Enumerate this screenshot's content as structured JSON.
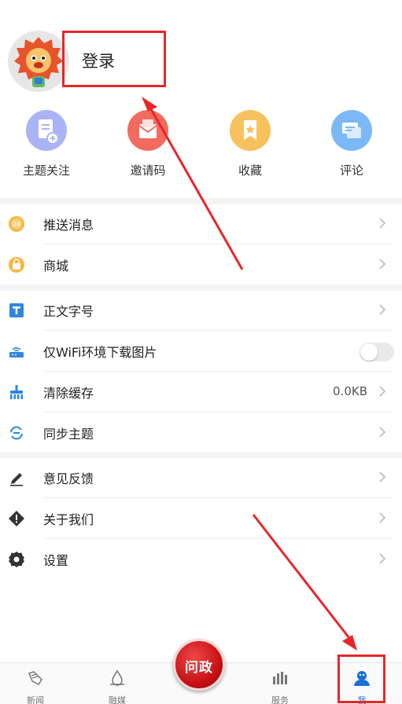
{
  "profile": {
    "login_label": "登录"
  },
  "quick_actions": [
    {
      "label": "主题关注",
      "icon": "topic-follow-icon",
      "color": "#aab3f5"
    },
    {
      "label": "邀请码",
      "icon": "invite-code-icon",
      "color": "#f36a5f"
    },
    {
      "label": "收藏",
      "icon": "favorite-icon",
      "color": "#f7c15d"
    },
    {
      "label": "评论",
      "icon": "comment-icon",
      "color": "#7cb8f5"
    }
  ],
  "section1": [
    {
      "label": "推送消息",
      "icon": "push-message-icon"
    },
    {
      "label": "商城",
      "icon": "mall-icon"
    }
  ],
  "section2": [
    {
      "label": "正文字号",
      "icon": "font-size-icon"
    },
    {
      "label": "仅WiFi环境下载图片",
      "icon": "wifi-router-icon",
      "toggle_on": false
    },
    {
      "label": "清除缓存",
      "icon": "clear-cache-icon",
      "value": "0.0KB"
    },
    {
      "label": "同步主题",
      "icon": "sync-icon"
    }
  ],
  "section3": [
    {
      "label": "意见反馈",
      "icon": "feedback-pen-icon"
    },
    {
      "label": "关于我们",
      "icon": "about-icon"
    },
    {
      "label": "设置",
      "icon": "settings-gear-icon"
    }
  ],
  "bottom_nav": {
    "tabs": [
      {
        "label": "新闻",
        "icon": "news-icon"
      },
      {
        "label": "融媒",
        "icon": "media-icon"
      },
      {
        "label": "服务",
        "icon": "service-icon"
      },
      {
        "label": "我",
        "icon": "me-icon"
      }
    ],
    "center_label": "问政"
  },
  "colors": {
    "accent_red": "#e8262a",
    "active_tab": "#1a6fd6"
  }
}
